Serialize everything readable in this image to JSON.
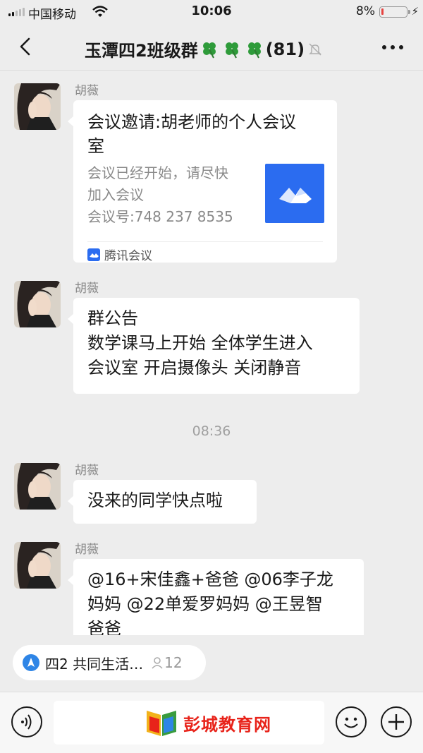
{
  "status_bar": {
    "carrier": "中国移动",
    "time": "10:06",
    "battery_percent": "8%",
    "battery_level": 0.08,
    "battery_color": "#e64340"
  },
  "nav": {
    "title_prefix": "玉潭四2班级群",
    "member_count": "(81)",
    "back_icon": "chevron-left-icon",
    "more_icon": "more-dots-icon",
    "mute_icon": "bell-muted-icon",
    "clover_icon": "four-leaf-clover-icon"
  },
  "messages": [
    {
      "sender": "胡薇",
      "type": "card",
      "card": {
        "title": "会议邀请:胡老师的个人会议室",
        "desc_lines": [
          "会议已经开始，请尽快",
          "加入会议",
          "会议号:748 237 8535"
        ],
        "source": "腾讯会议"
      }
    },
    {
      "sender": "胡薇",
      "type": "text",
      "lines": [
        "群公告",
        "数学课马上开始 全体学生进入",
        "会议室 开启摄像头 关闭静音"
      ]
    },
    {
      "sender": "胡薇",
      "type": "text",
      "lines": [
        "没来的同学快点啦"
      ]
    },
    {
      "sender": "胡薇",
      "type": "text",
      "lines": [
        "@16+宋佳鑫+爸爸 @06李子龙",
        "妈妈 @22单爱罗妈妈 @王昱智",
        "爸爸"
      ]
    }
  ],
  "time_separator": "08:36",
  "pinned": {
    "label": "四2 共同生活…",
    "count": "12"
  },
  "input_bar": {
    "watermark": "彭城教育网",
    "voice_icon": "voice-icon",
    "emoji_icon": "emoji-icon",
    "plus_icon": "plus-icon"
  },
  "colors": {
    "background": "#ededed",
    "bubble": "#ffffff",
    "tencent_meeting_blue": "#2b6cf0",
    "watermark_red": "#e8231a"
  }
}
